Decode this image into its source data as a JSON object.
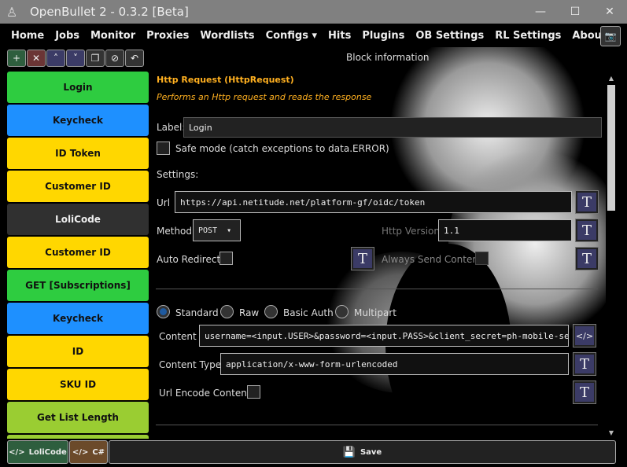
{
  "window": {
    "title": "OpenBullet 2 - 0.3.2 [Beta]"
  },
  "nav": [
    "Home",
    "Jobs",
    "Monitor",
    "Proxies",
    "Wordlists",
    "Configs ▾",
    "Hits",
    "Plugins",
    "OB Settings",
    "RL Settings",
    "About"
  ],
  "toolbar": {
    "icons": [
      "plus-icon",
      "close-icon",
      "chevron-up-icon",
      "chevron-down-icon",
      "clone-icon",
      "disable-icon",
      "undo-icon"
    ]
  },
  "blocks": [
    {
      "label": "Login",
      "color": "#2ecc40"
    },
    {
      "label": "Keycheck",
      "color": "#1e90ff"
    },
    {
      "label": "ID Token",
      "color": "#ffd700"
    },
    {
      "label": "Customer ID",
      "color": "#ffd700"
    },
    {
      "label": "LoliCode",
      "color": "#303030"
    },
    {
      "label": "Customer ID",
      "color": "#ffd700"
    },
    {
      "label": "GET [Subscriptions]",
      "color": "#2ecc40"
    },
    {
      "label": "Keycheck",
      "color": "#1e90ff"
    },
    {
      "label": "ID",
      "color": "#ffd700"
    },
    {
      "label": "SKU ID",
      "color": "#ffd700"
    },
    {
      "label": "Get List Length",
      "color": "#9acd32"
    },
    {
      "label": "",
      "color": "#9acd32"
    }
  ],
  "panel": {
    "header": "Block information",
    "block_title": "Http Request (HttpRequest)",
    "block_desc": "Performs an Http request and reads the response",
    "label_label": "Label:",
    "label_value": "Login",
    "safe_mode": "Safe mode (catch exceptions to data.ERROR)",
    "settings": "Settings:",
    "url_label": "Url",
    "url_value": "https://api.netitude.net/platform-gf/oidc/token",
    "method_label": "Method",
    "method_value": "POST",
    "http_version_label": "Http Version",
    "http_version_value": "1.1",
    "auto_redirect": "Auto Redirect",
    "always_send": "Always Send Content",
    "modes": [
      "Standard",
      "Raw",
      "Basic Auth",
      "Multipart"
    ],
    "selected_mode": "Standard",
    "content_label": "Content",
    "content_value": "username=<input.USER>&password=<input.PASS>&client_secret=ph-mobile-se",
    "content_type_label": "Content Type",
    "content_type_value": "application/x-www-form-urlencoded",
    "url_encode": "Url Encode Content"
  },
  "bottom": {
    "lolicode": "LoliCode",
    "csharp": "C#",
    "save": "Save"
  }
}
